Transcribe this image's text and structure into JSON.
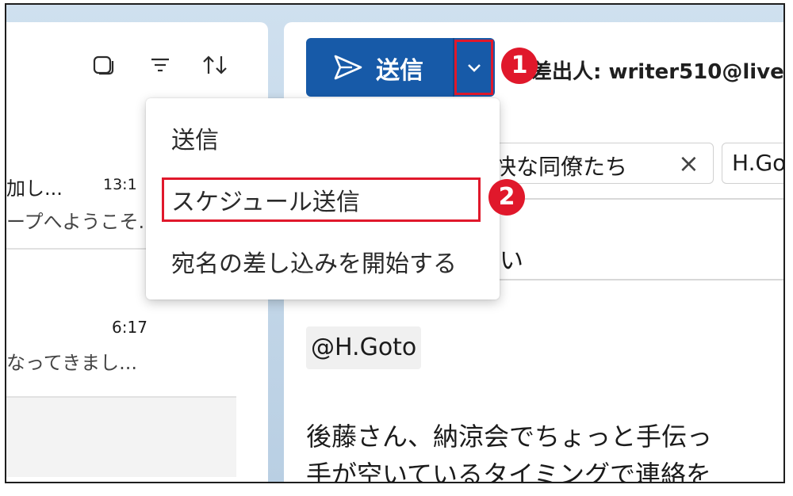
{
  "left_pane": {
    "mail_items": [
      {
        "preview_line1": "加し...",
        "time": "13:1",
        "preview_line2": "ープへようこそ..."
      },
      {
        "time": "6:17",
        "preview_line1": "なってきまし..."
      }
    ]
  },
  "compose": {
    "send_label": "送信",
    "from_text": "差出人: writer510@live",
    "recipients": [
      {
        "label": "快な同僚たち",
        "remove_glyph": "×"
      },
      {
        "label": "H.Go"
      }
    ],
    "subject_fragment": "い",
    "mention": "@H.Goto",
    "body_lines": [
      "後藤さん、納涼会でちょっと手伝っ",
      "手が空いているタイミングで連絡を"
    ]
  },
  "send_menu": {
    "items": [
      "送信",
      "スケジュール送信",
      "宛名の差し込みを開始する"
    ]
  },
  "annotations": {
    "badge1": "1",
    "badge2": "2",
    "highlight_color": "#e0182b"
  },
  "colors": {
    "send_button": "#175aa8",
    "background": "#b9cfe3"
  },
  "icons": [
    "layout-icon",
    "filter-icon",
    "sort-icon",
    "send-icon",
    "chevron-down-icon",
    "close-icon"
  ]
}
